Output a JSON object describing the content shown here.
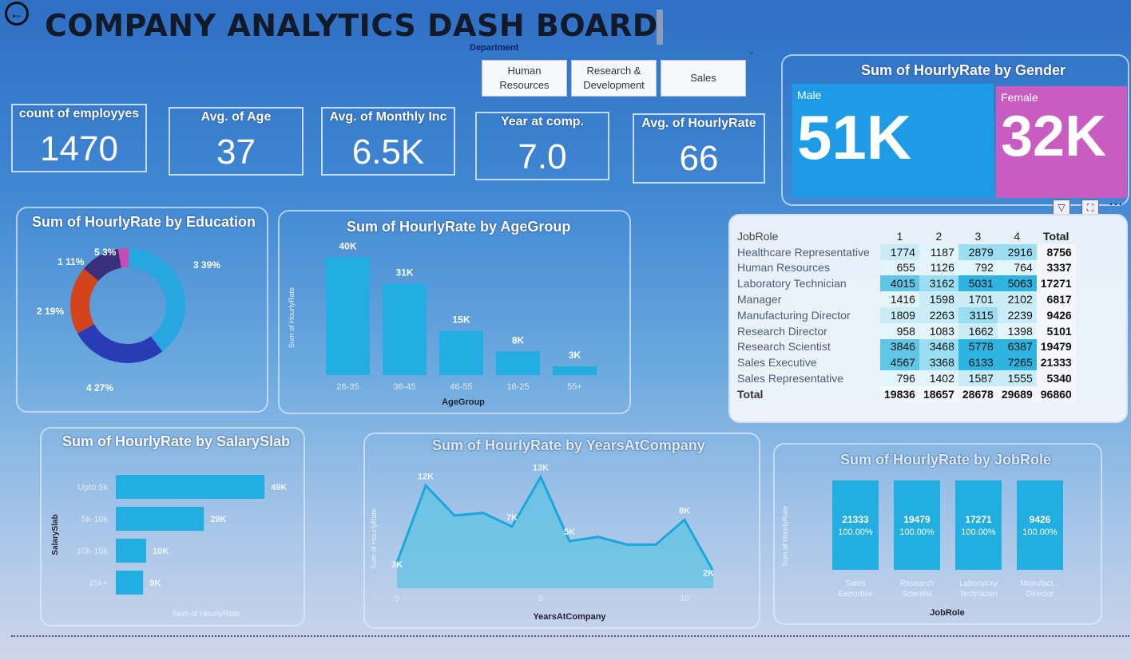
{
  "header": {
    "title": "COMPANY ANALYTICS DASH BOARD",
    "back_icon": "back-arrow-icon"
  },
  "slicer": {
    "label": "Department",
    "options": [
      "Human Resources",
      "Research & Development",
      "Sales"
    ]
  },
  "kpis": [
    {
      "label": "count of employyes",
      "value": "1470"
    },
    {
      "label": "Avg. of Age",
      "value": "37"
    },
    {
      "label": "Avg. of Monthly Inc",
      "value": "6.5K"
    },
    {
      "label": "Year at comp.",
      "value": "7.0"
    },
    {
      "label": "Avg. of HourlyRate",
      "value": "66"
    }
  ],
  "gender": {
    "title": "Sum of HourlyRate by Gender",
    "male_label": "Male",
    "male_value": "51K",
    "male_color": "#1e9be6",
    "female_label": "Female",
    "female_value": "32K",
    "female_color": "#c85cc0"
  },
  "visual_icons": [
    "filter-icon",
    "focus-mode-icon",
    "more-options-icon"
  ],
  "education": {
    "title": "Sum of HourlyRate by Education",
    "labels": [
      "5 3%",
      "1 11%",
      "3 39%",
      "2 19%",
      "4 27%"
    ],
    "chart_data": {
      "type": "pie",
      "categories": [
        "3",
        "4",
        "2",
        "1",
        "5"
      ],
      "values": [
        39,
        27,
        19,
        11,
        3
      ],
      "colors": [
        "#27a7e0",
        "#2a3cb5",
        "#d2441c",
        "#3a2f7a",
        "#c94bb8"
      ]
    }
  },
  "agegroup": {
    "title": "Sum of HourlyRate by AgeGroup",
    "xlabel": "AgeGroup",
    "ylabel": "Sum of HourlyRate",
    "labels": [
      "40K",
      "31K",
      "15K",
      "8K",
      "3K"
    ],
    "chart_data": {
      "type": "bar",
      "categories": [
        "26-35",
        "36-45",
        "46-55",
        "18-25",
        "55+"
      ],
      "values": [
        40,
        31,
        15,
        8,
        3
      ],
      "ylim": [
        0,
        42
      ]
    }
  },
  "matrix": {
    "corner": "JobRole",
    "columns": [
      "1",
      "2",
      "3",
      "4",
      "Total"
    ],
    "rows": [
      {
        "role": "Healthcare Representative",
        "v": [
          "1774",
          "1187",
          "2879",
          "2916",
          "8756"
        ]
      },
      {
        "role": "Human Resources",
        "v": [
          "655",
          "1126",
          "792",
          "764",
          "3337"
        ]
      },
      {
        "role": "Laboratory Technician",
        "v": [
          "4015",
          "3162",
          "5031",
          "5063",
          "17271"
        ]
      },
      {
        "role": "Manager",
        "v": [
          "1416",
          "1598",
          "1701",
          "2102",
          "6817"
        ]
      },
      {
        "role": "Manufacturing Director",
        "v": [
          "1809",
          "2263",
          "3115",
          "2239",
          "9426"
        ]
      },
      {
        "role": "Research Director",
        "v": [
          "958",
          "1083",
          "1662",
          "1398",
          "5101"
        ]
      },
      {
        "role": "Research Scientist",
        "v": [
          "3846",
          "3468",
          "5778",
          "6387",
          "19479"
        ]
      },
      {
        "role": "Sales Executive",
        "v": [
          "4567",
          "3368",
          "6133",
          "7265",
          "21333"
        ]
      },
      {
        "role": "Sales Representative",
        "v": [
          "796",
          "1402",
          "1587",
          "1555",
          "5340"
        ]
      }
    ],
    "total": {
      "role": "Total",
      "v": [
        "19836",
        "18657",
        "28678",
        "29689",
        "96860"
      ]
    }
  },
  "salary": {
    "title": "Sum of HourlyRate by SalarySlab",
    "xlabel": "Sum of HourlyRate",
    "ylabel": "SalarySlab",
    "labels": [
      "49K",
      "29K",
      "10K",
      "9K"
    ],
    "chart_data": {
      "type": "bar",
      "orientation": "horizontal",
      "categories": [
        "Upto 5k",
        "5k-10k",
        "10k-15k",
        "15k+"
      ],
      "values": [
        49,
        29,
        10,
        9
      ],
      "xlim": [
        0,
        50
      ]
    }
  },
  "years": {
    "title": "Sum of HourlyRate by YearsAtCompany",
    "xlabel": "YearsAtCompany",
    "ylabel": "Sum of HourlyRate",
    "xticks": [
      "0",
      "5",
      "10"
    ],
    "labels": [
      "12K",
      "13K",
      "7K",
      "5K",
      "8K",
      "3K",
      "2K"
    ],
    "chart_data": {
      "type": "area",
      "x": [
        0,
        1,
        2,
        3,
        4,
        5,
        6,
        7,
        8,
        9,
        10,
        11
      ],
      "values": [
        3,
        12,
        8.5,
        8.8,
        7.2,
        13,
        5.5,
        6,
        5.1,
        5.1,
        8,
        2
      ],
      "ylim": [
        0,
        14
      ]
    }
  },
  "jobrole": {
    "title": "Sum of HourlyRate by JobRole",
    "xlabel": "JobRole",
    "ylabel": "Sum of HourlyRate",
    "chart_data": {
      "type": "bar",
      "categories": [
        "Sales Executive",
        "Research Scientist",
        "Laboratory Technician",
        "Manufact... Director"
      ],
      "values": [
        21333,
        19479,
        17271,
        9426
      ],
      "labels": [
        "21333",
        "19479",
        "17271",
        "9426"
      ],
      "pct": [
        "100.00%",
        "100.00%",
        "100.00%",
        "100.00%"
      ]
    }
  }
}
